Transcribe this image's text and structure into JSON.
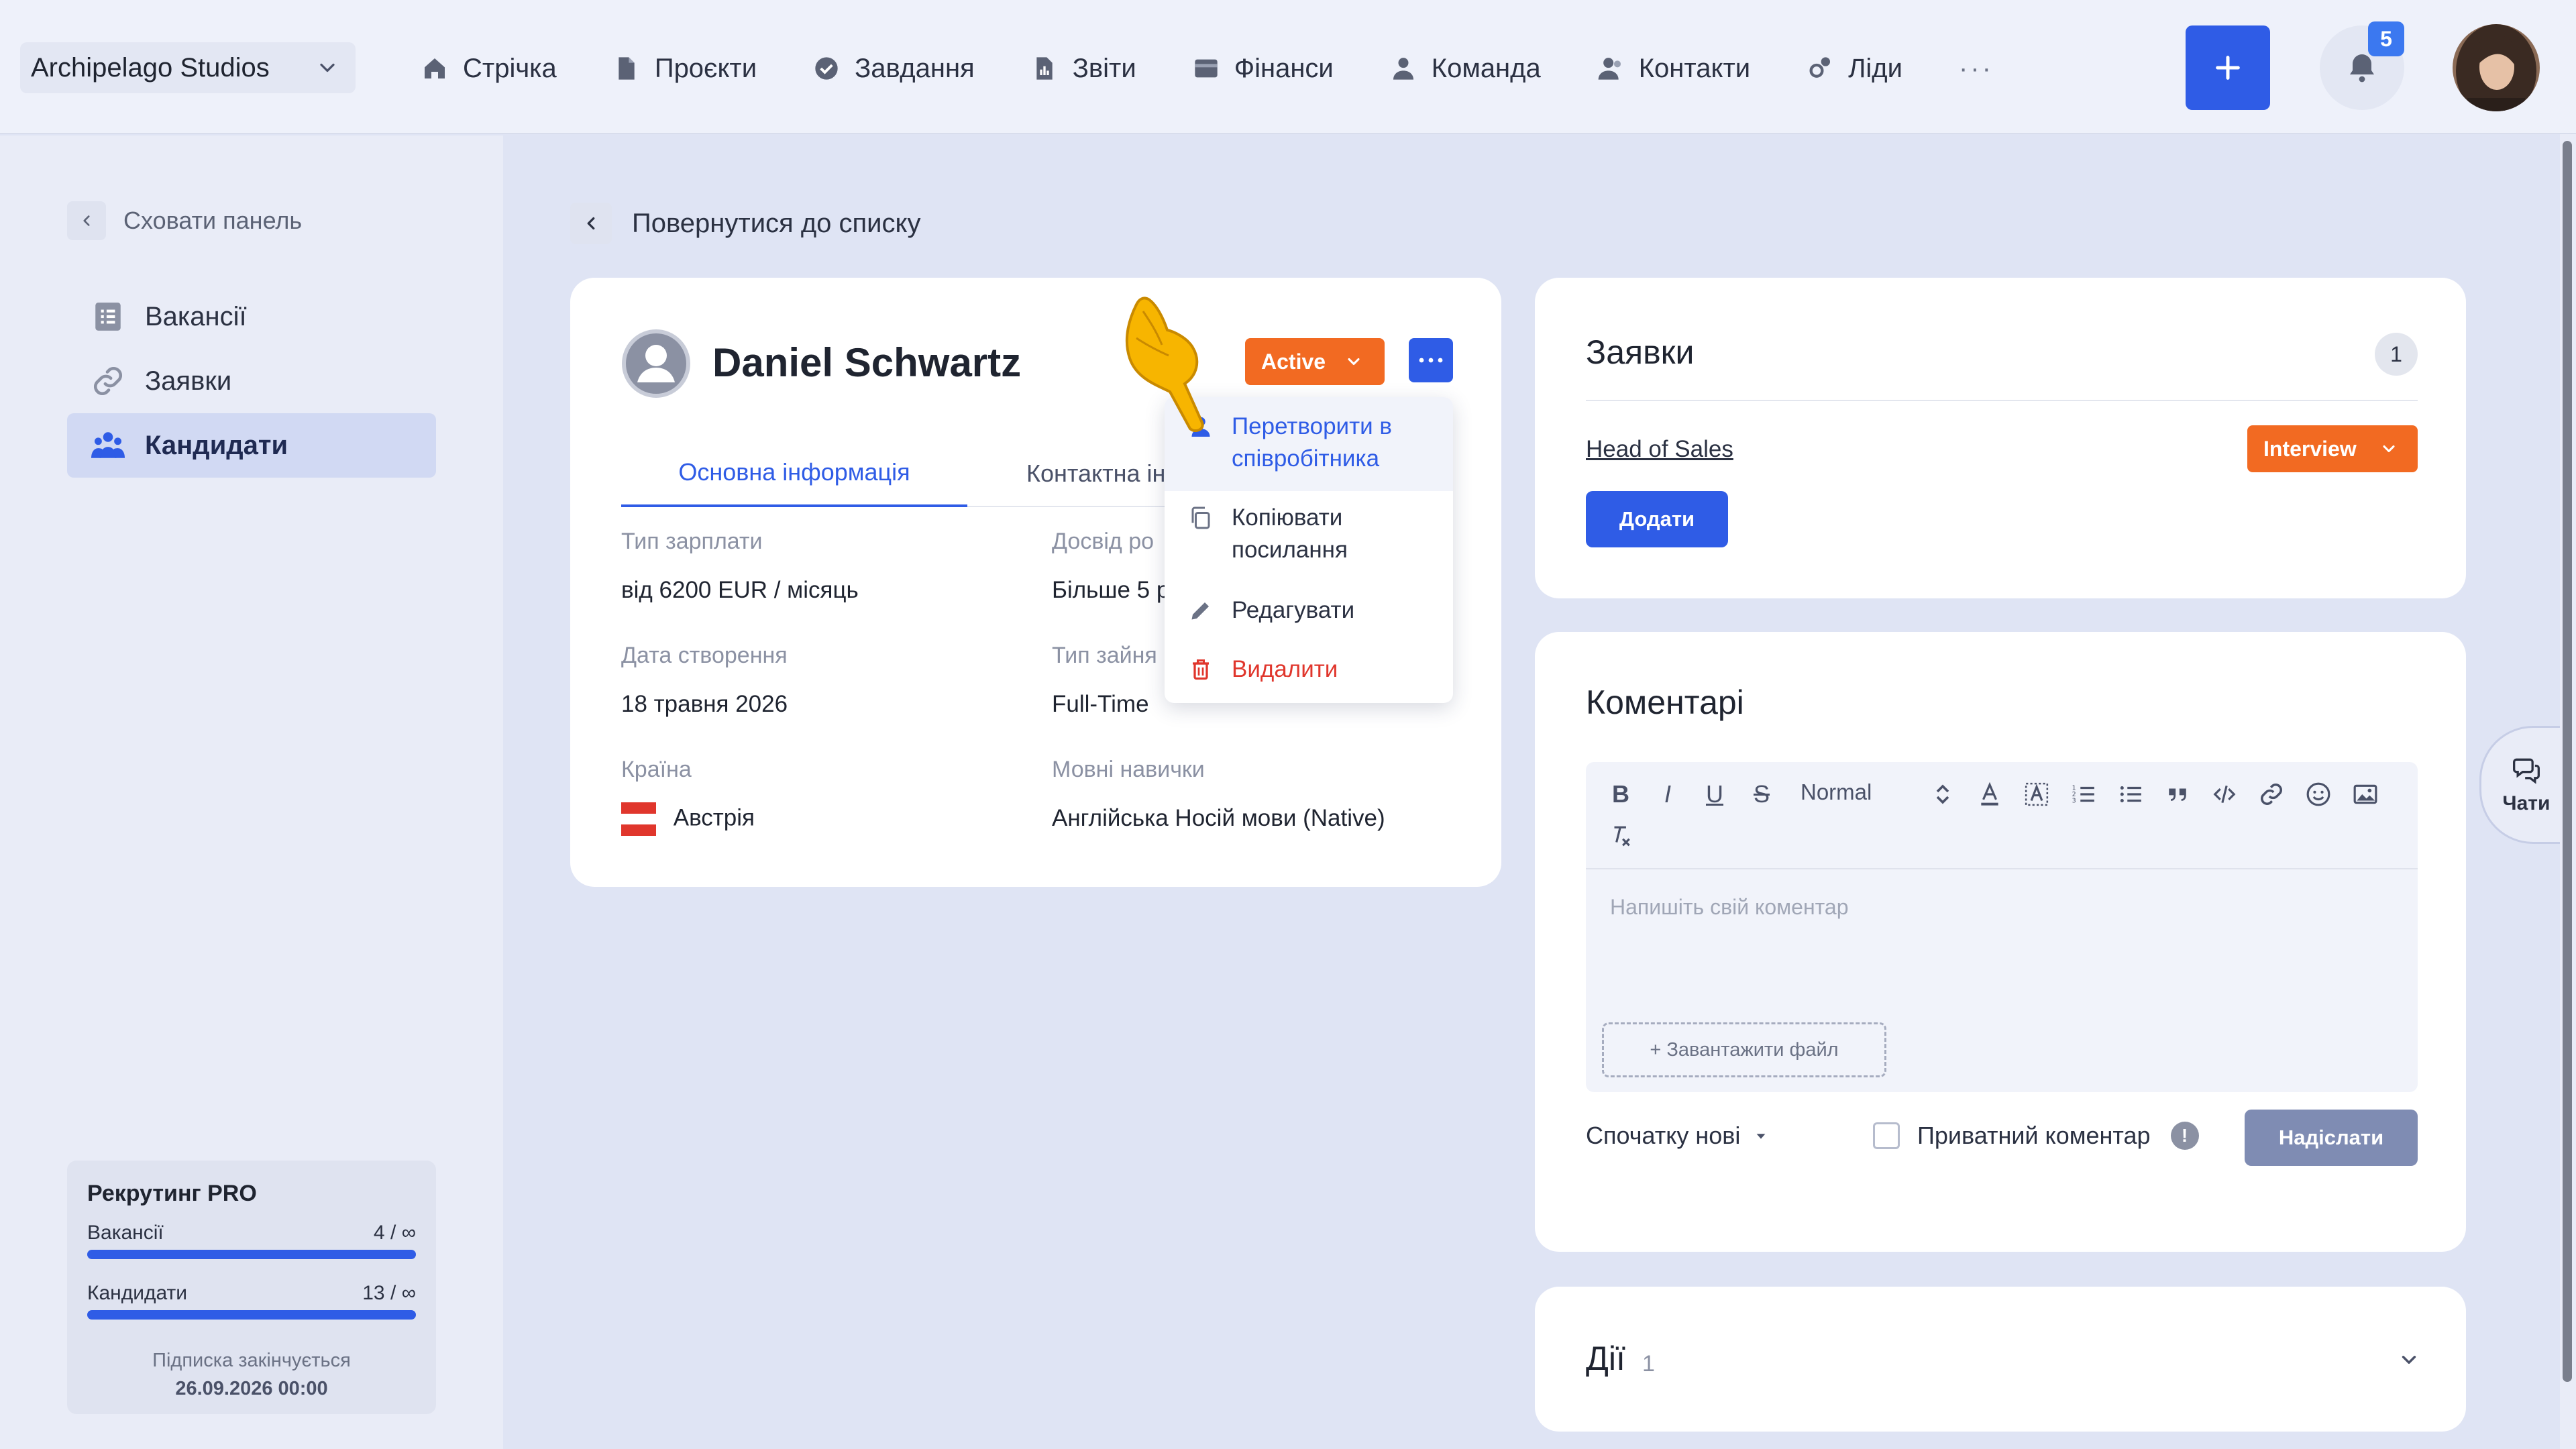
{
  "header": {
    "company": "Archipelago Studios",
    "nav": [
      {
        "label": "Стрічка",
        "icon": "home-icon"
      },
      {
        "label": "Проєкти",
        "icon": "document-icon"
      },
      {
        "label": "Завдання",
        "icon": "check-circle-icon"
      },
      {
        "label": "Звіти",
        "icon": "report-icon"
      },
      {
        "label": "Фінанси",
        "icon": "wallet-icon"
      },
      {
        "label": "Команда",
        "icon": "user-icon"
      },
      {
        "label": "Контакти",
        "icon": "contacts-icon"
      },
      {
        "label": "Ліди",
        "icon": "leads-icon"
      }
    ],
    "more": "···",
    "notifications_count": "5"
  },
  "sidebar": {
    "hide_label": "Сховати панель",
    "items": [
      {
        "label": "Вакансії",
        "icon": "list-icon"
      },
      {
        "label": "Заявки",
        "icon": "link-icon"
      },
      {
        "label": "Кандидати",
        "icon": "people-icon",
        "active": true
      }
    ],
    "plan": {
      "title": "Рекрутинг PRO",
      "rows": [
        {
          "label": "Вакансії",
          "value": "4 / ∞"
        },
        {
          "label": "Кандидати",
          "value": "13 / ∞"
        }
      ],
      "expires_label": "Підписка закінчується",
      "expires_date": "26.09.2026 00:00"
    }
  },
  "main": {
    "back_label": "Повернутися до списку",
    "candidate": {
      "name": "Daniel Schwartz",
      "status": "Active",
      "tabs": [
        "Основна інформація",
        "Контактна ін"
      ],
      "fields": {
        "salary_label": "Тип зарплати",
        "salary_value": "від 6200 EUR / місяць",
        "experience_label": "Досвід ро",
        "experience_value": "Більше 5 р",
        "created_label": "Дата створення",
        "created_value": "18 травня 2026",
        "employment_label": "Тип зайня",
        "employment_value": "Full-Time",
        "country_label": "Країна",
        "country_value": "Австрія",
        "languages_label": "Мовні навички",
        "languages_value": "Англійська Носій мови (Native)"
      }
    },
    "menu": {
      "convert_line1": "Перетворити в",
      "convert_line2": "співробітника",
      "copy_line1": "Копіювати",
      "copy_line2": "посилання",
      "edit": "Редагувати",
      "delete": "Видалити"
    }
  },
  "applications": {
    "title": "Заявки",
    "count": "1",
    "position": "Head of Sales",
    "stage": "Interview",
    "add_label": "Додати"
  },
  "comments": {
    "title": "Коментарі",
    "format_label": "Normal",
    "placeholder": "Напишіть свій коментар",
    "upload_label": "+ Завантажити файл",
    "sort_label": "Спочатку нові",
    "private_label": "Приватний коментар",
    "send_label": "Надіслати"
  },
  "actions": {
    "title": "Дії",
    "count": "1"
  },
  "chats_label": "Чати",
  "colors": {
    "accent": "#2f5ce6",
    "status_orange": "#f26a22",
    "danger": "#e0362c"
  }
}
